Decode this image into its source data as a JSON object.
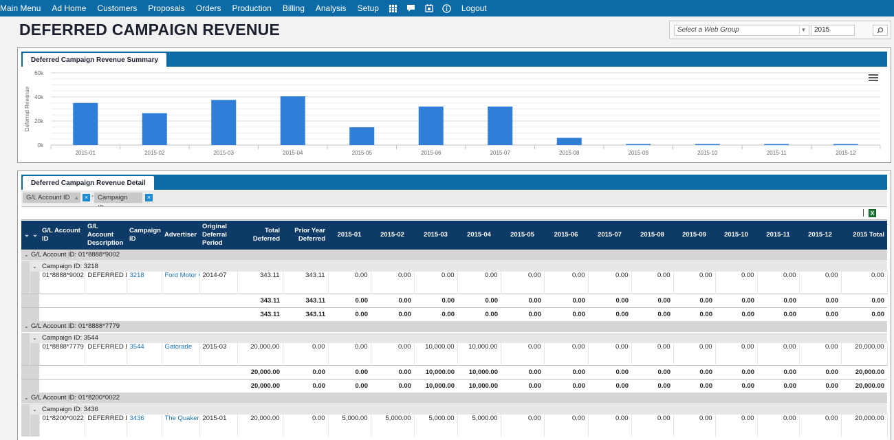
{
  "nav": {
    "items": [
      "Main Menu",
      "Ad Home",
      "Customers",
      "Proposals",
      "Orders",
      "Production",
      "Billing",
      "Analysis",
      "Setup"
    ],
    "logout": "Logout"
  },
  "page": {
    "title": "DEFERRED CAMPAIGN REVENUE"
  },
  "filter": {
    "webgroup_placeholder": "Select a Web Group",
    "year": "2015"
  },
  "summary": {
    "tab_label": "Deferred Campaign Revenue Summary"
  },
  "chart_data": {
    "type": "bar",
    "title": "",
    "ylabel": "Deferred Revenue",
    "ylim": [
      0,
      60000
    ],
    "yticks": [
      "0k",
      "20k",
      "40k",
      "60k"
    ],
    "categories": [
      "2015-01",
      "2015-02",
      "2015-03",
      "2015-04",
      "2015-05",
      "2015-06",
      "2015-07",
      "2015-08",
      "2015-09",
      "2015-10",
      "2015-11",
      "2015-12"
    ],
    "values": [
      35000,
      26500,
      37500,
      40500,
      14800,
      32000,
      32000,
      6000,
      0,
      0,
      0,
      0
    ],
    "bar_color": "#2f7ed8",
    "grid": true
  },
  "detail": {
    "tab_label": "Deferred Campaign Revenue Detail",
    "group_chips": [
      "G/L Account ID",
      "Campaign ID"
    ],
    "columns": [
      "G/L Account ID",
      "G/L Account Description",
      "Campaign ID",
      "Advertiser",
      "Original Deferral Period",
      "Total Deferred",
      "Prior Year Deferred",
      "2015-01",
      "2015-02",
      "2015-03",
      "2015-04",
      "2015-05",
      "2015-06",
      "2015-07",
      "2015-08",
      "2015-09",
      "2015-10",
      "2015-11",
      "2015-12",
      "2015 Total"
    ],
    "groups": [
      {
        "gl_label": "G/L Account ID: 01*8888*9002",
        "campaign_label": "Campaign ID: 3218",
        "row": [
          "01*8888*9002",
          "DEFERRED INCOME",
          "3218",
          "Ford Motor Cars",
          "2014-07",
          "343.11",
          "343.11",
          "0.00",
          "0.00",
          "0.00",
          "0.00",
          "0.00",
          "0.00",
          "0.00",
          "0.00",
          "0.00",
          "0.00",
          "0.00",
          "0.00",
          "0.00"
        ],
        "subtotal": [
          "343.11",
          "343.11",
          "0.00",
          "0.00",
          "0.00",
          "0.00",
          "0.00",
          "0.00",
          "0.00",
          "0.00",
          "0.00",
          "0.00",
          "0.00",
          "0.00",
          "0.00"
        ],
        "total": [
          "343.11",
          "343.11",
          "0.00",
          "0.00",
          "0.00",
          "0.00",
          "0.00",
          "0.00",
          "0.00",
          "0.00",
          "0.00",
          "0.00",
          "0.00",
          "0.00",
          "0.00"
        ]
      },
      {
        "gl_label": "G/L Account ID: 01*8888*7779",
        "campaign_label": "Campaign ID: 3544",
        "row": [
          "01*8888*7779",
          "DEFERRED REVENUE",
          "3544",
          "Gatorade",
          "2015-03",
          "20,000.00",
          "0.00",
          "0.00",
          "0.00",
          "10,000.00",
          "10,000.00",
          "0.00",
          "0.00",
          "0.00",
          "0.00",
          "0.00",
          "0.00",
          "0.00",
          "0.00",
          "20,000.00"
        ],
        "subtotal": [
          "20,000.00",
          "0.00",
          "0.00",
          "0.00",
          "10,000.00",
          "10,000.00",
          "0.00",
          "0.00",
          "0.00",
          "0.00",
          "0.00",
          "0.00",
          "0.00",
          "0.00",
          "20,000.00"
        ],
        "total": [
          "20,000.00",
          "0.00",
          "0.00",
          "0.00",
          "10,000.00",
          "10,000.00",
          "0.00",
          "0.00",
          "0.00",
          "0.00",
          "0.00",
          "0.00",
          "0.00",
          "0.00",
          "20,000.00"
        ]
      },
      {
        "gl_label": "G/L Account ID: 01*8200*0022",
        "campaign_label": "Campaign ID: 3436",
        "row": [
          "01*8200*0022",
          "DEFERRED REVENUE",
          "3436",
          "The Quaker Oats Company",
          "2015-01",
          "20,000.00",
          "0.00",
          "5,000.00",
          "5,000.00",
          "5,000.00",
          "5,000.00",
          "0.00",
          "0.00",
          "0.00",
          "0.00",
          "0.00",
          "0.00",
          "0.00",
          "0.00",
          "20,000.00"
        ]
      }
    ]
  }
}
